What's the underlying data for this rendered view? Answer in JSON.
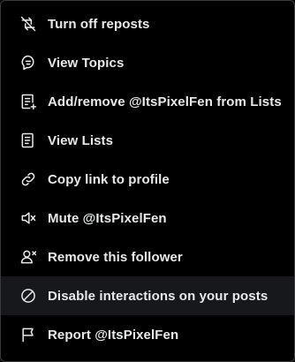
{
  "menu": {
    "items": [
      {
        "label": "Turn off reposts",
        "icon": "repost-off-icon"
      },
      {
        "label": "View Topics",
        "icon": "topics-icon"
      },
      {
        "label": "Add/remove @ItsPixelFen from Lists",
        "icon": "list-add-icon"
      },
      {
        "label": "View Lists",
        "icon": "list-icon"
      },
      {
        "label": "Copy link to profile",
        "icon": "link-icon"
      },
      {
        "label": "Mute @ItsPixelFen",
        "icon": "mute-icon"
      },
      {
        "label": "Remove this follower",
        "icon": "remove-follower-icon"
      },
      {
        "label": "Disable interactions on your posts",
        "icon": "block-icon"
      },
      {
        "label": "Report @ItsPixelFen",
        "icon": "flag-icon"
      }
    ]
  }
}
